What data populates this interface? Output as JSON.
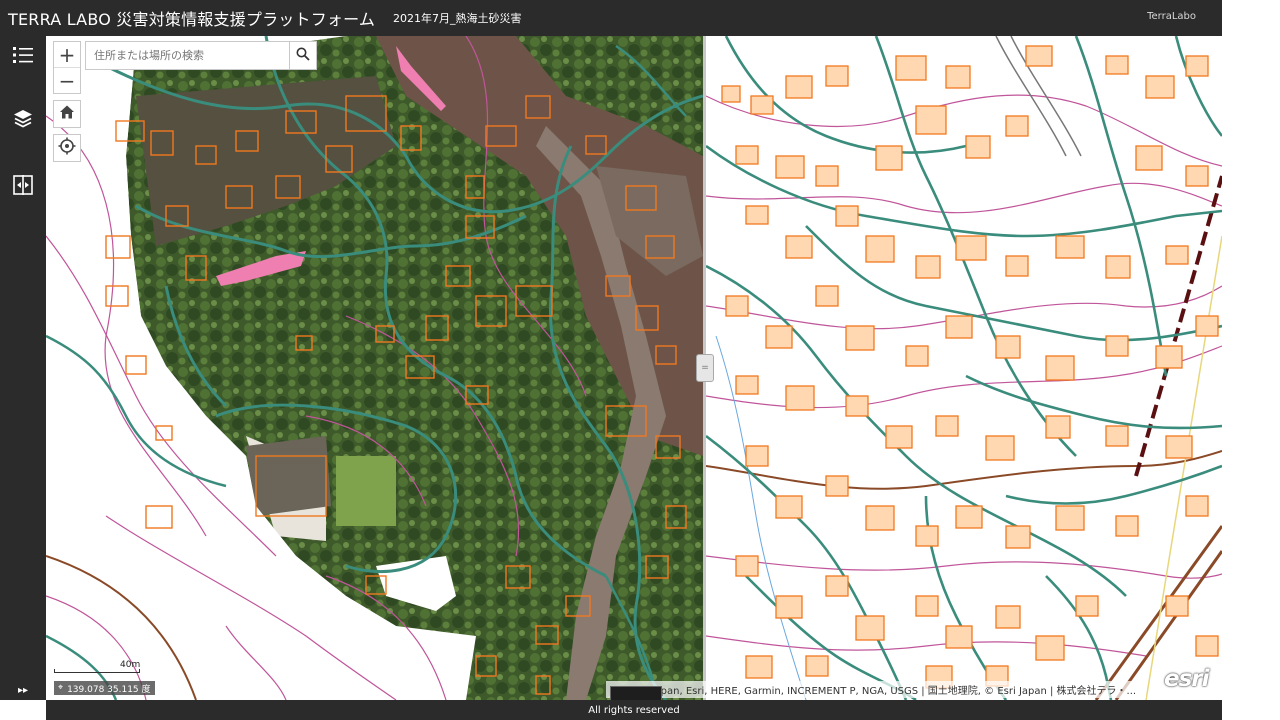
{
  "header": {
    "title": "TERRA LABO 災害対策情報支援プラットフォーム",
    "subtitle": "2021年7月_熱海土砂災害",
    "user": "TerraLabo"
  },
  "sidebar": {
    "tools": [
      {
        "name": "layer-list",
        "icon": "list-icon"
      },
      {
        "name": "basemap-gallery",
        "icon": "layers-icon"
      },
      {
        "name": "swipe-compare",
        "icon": "swipe-icon"
      }
    ],
    "expand_icon": "▸▸"
  },
  "map": {
    "zoom_in": "+",
    "zoom_out": "−",
    "search": {
      "placeholder": "住所または場所の検索",
      "value": ""
    },
    "scale_label": "40m",
    "coordinates": "139.078 35.115 度",
    "attribution": "Esri Japan, Esri, HERE, Garmin, INCREMENT P, NGA, USGS | 国土地理院, © Esri Japan | 株式会社テラ・...",
    "esri_logo": "esri",
    "swipe_handle": "="
  },
  "footer": {
    "text": "All rights reserved"
  },
  "colors": {
    "chrome": "#2b2b2b",
    "road": "#3a8c7c",
    "building_outline": "#f07820",
    "building_fill": "#ffd7b0",
    "contour": "#c0559a",
    "contour_index": "#8a4a28",
    "imagery": "#3f5a2c",
    "debris": "#6e5448"
  }
}
